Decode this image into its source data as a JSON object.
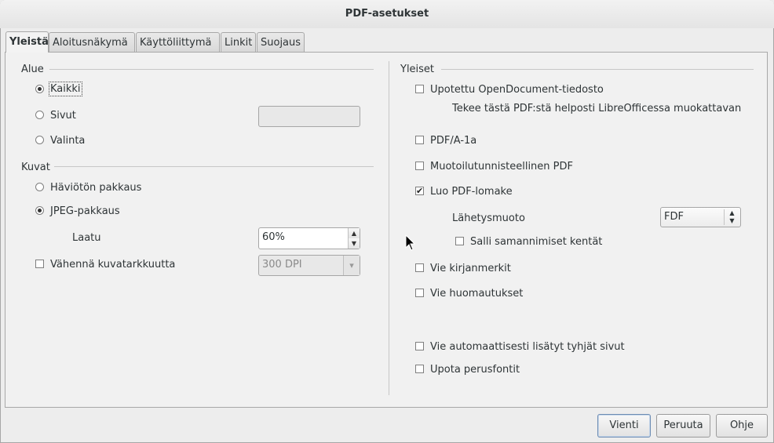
{
  "window": {
    "title": "PDF-asetukset"
  },
  "tabs": [
    {
      "label": "Yleistä",
      "active": true
    },
    {
      "label": "Aloitusnäkymä",
      "active": false
    },
    {
      "label": "Käyttöliittymä",
      "active": false
    },
    {
      "label": "Linkit",
      "active": false
    },
    {
      "label": "Suojaus",
      "active": false
    }
  ],
  "range": {
    "heading": "Alue",
    "all_label": "Kaikki",
    "pages_label": "Sivut",
    "pages_value": "",
    "selection_label": "Valinta",
    "selected": "Kaikki"
  },
  "images": {
    "heading": "Kuvat",
    "lossless_label": "Häviötön pakkaus",
    "jpeg_label": "JPEG-pakkaus",
    "quality_label": "Laatu",
    "quality_value": "60%",
    "reduce_label": "Vähennä kuvatarkkuutta",
    "reduce_checked": false,
    "resolution_value": "300 DPI"
  },
  "general": {
    "heading": "Yleiset",
    "embed_label": "Upotettu OpenDocument-tiedosto",
    "embed_desc": "Tekee tästä PDF:stä helposti LibreOfficessa muokattavan",
    "embed_checked": false,
    "pdfa_label": "PDF/A-1a",
    "pdfa_checked": false,
    "tagged_label": "Muotoilutunnisteellinen PDF",
    "tagged_checked": false,
    "form_label": "Luo PDF-lomake",
    "form_checked": true,
    "submit_label": "Lähetysmuoto",
    "submit_value": "FDF",
    "dup_label": "Salli samannimiset kentät",
    "dup_checked": false,
    "bookmarks_label": "Vie kirjanmerkit",
    "bookmarks_checked": false,
    "comments_label": "Vie huomautukset",
    "comments_checked": false,
    "blank_label": "Vie automaattisesti lisätyt tyhjät sivut",
    "blank_checked": false,
    "fonts_label": "Upota perusfontit",
    "fonts_checked": false
  },
  "buttons": {
    "export": "Vienti",
    "cancel": "Peruuta",
    "help": "Ohje"
  },
  "icons": {
    "checkmark": "✔",
    "spin_up": "▲",
    "spin_down": "▼",
    "dropdown": "▾"
  }
}
